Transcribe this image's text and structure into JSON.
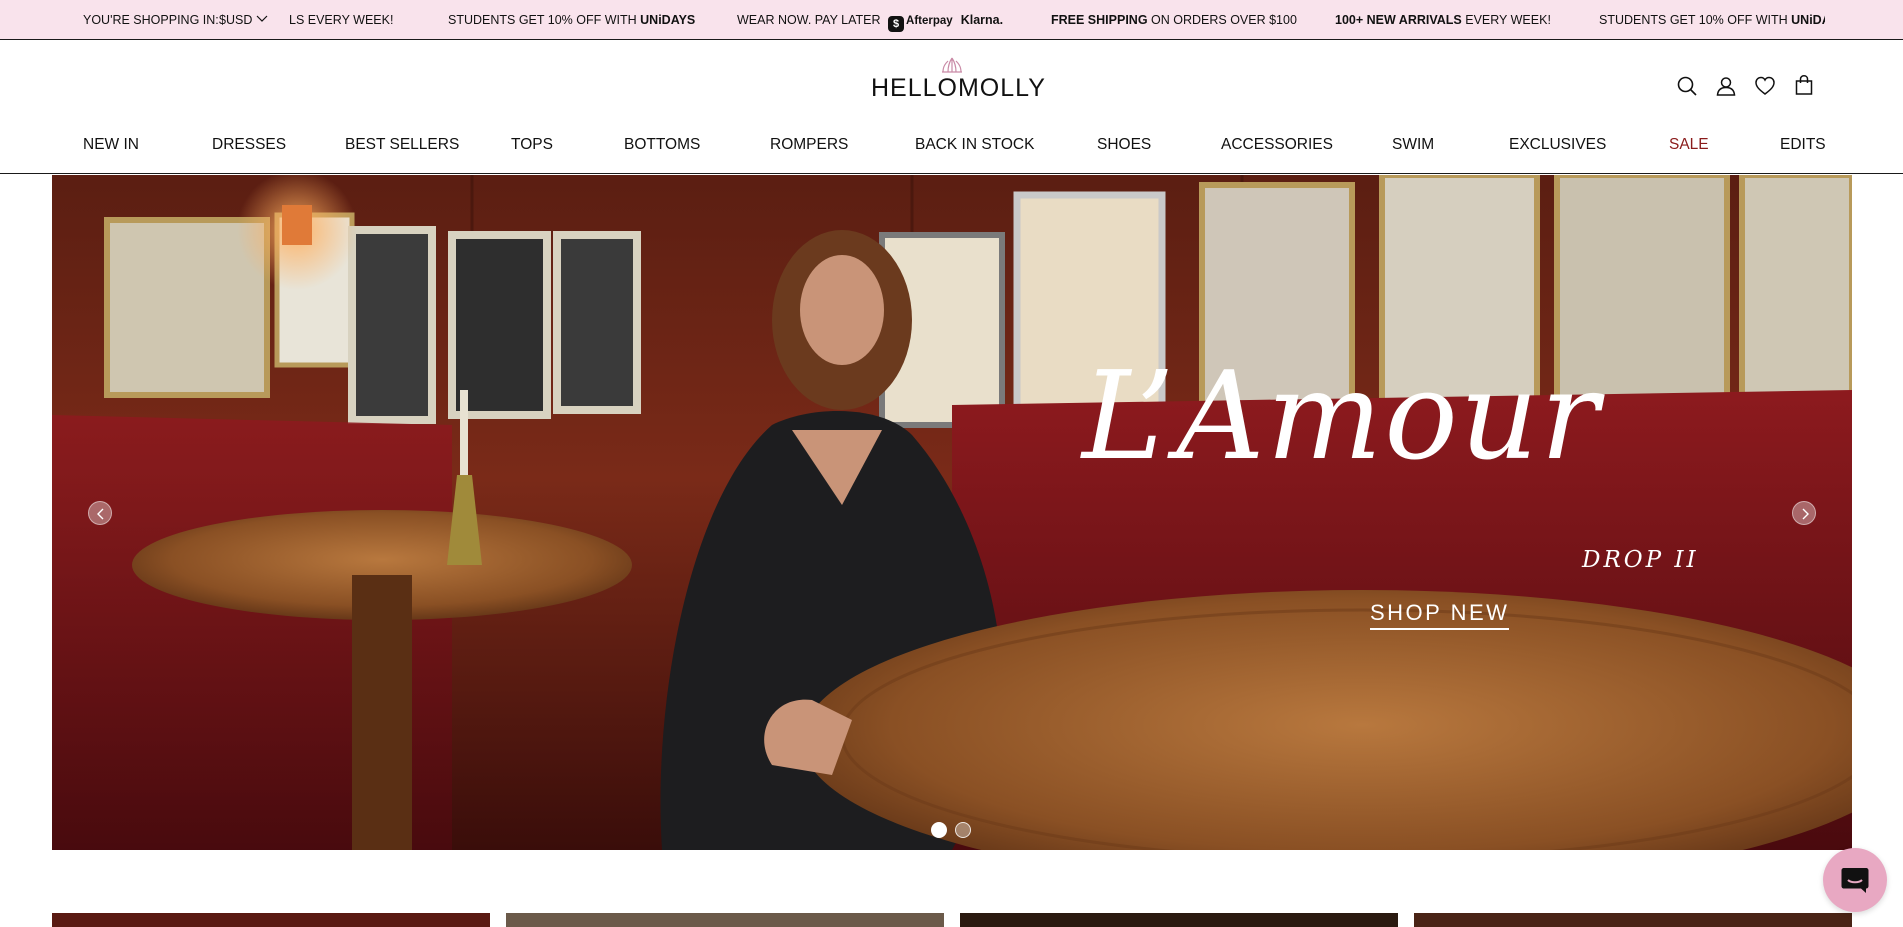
{
  "announcement": {
    "currency_label": "YOU'RE SHOPPING IN:",
    "currency_value": "$USD",
    "promos": [
      {
        "bold": "",
        "text": "LS EVERY WEEK!",
        "bold_after": ""
      },
      {
        "bold": "",
        "text": "STUDENTS GET 10% OFF WITH ",
        "bold_after": "UNiDAYS"
      },
      {
        "bold": "",
        "text": "WEAR NOW. PAY LATER",
        "bold_after": ""
      },
      {
        "bold": "FREE SHIPPING",
        "text": " ON ORDERS OVER $100",
        "bold_after": ""
      },
      {
        "bold": "100+ NEW ARRIVALS",
        "text": " EVERY WEEK!",
        "bold_after": ""
      },
      {
        "bold": "",
        "text": "STUDENTS GET 10% OFF WITH ",
        "bold_after": "UNiDAYS"
      }
    ],
    "afterpay": "Afterpay",
    "klarna": "Klarna."
  },
  "header": {
    "logo": "HELLOMOLLY",
    "icons": [
      "search-icon",
      "account-icon",
      "wishlist-icon",
      "bag-icon"
    ]
  },
  "nav": {
    "items": [
      "NEW IN",
      "DRESSES",
      "BEST SELLERS",
      "TOPS",
      "BOTTOMS",
      "ROMPERS",
      "BACK IN STOCK",
      "SHOES",
      "ACCESSORIES",
      "SWIM",
      "EXCLUSIVES",
      "SALE",
      "EDITS"
    ],
    "sale_color": "#8a1b1b"
  },
  "hero": {
    "title": "L’Amour",
    "subtitle": "DROP II",
    "cta": "SHOP NEW",
    "slide_count": 2,
    "active_slide": 1
  },
  "colors": {
    "announce_bg": "#f9e3ec",
    "chat_button": "#e8a8c2"
  }
}
